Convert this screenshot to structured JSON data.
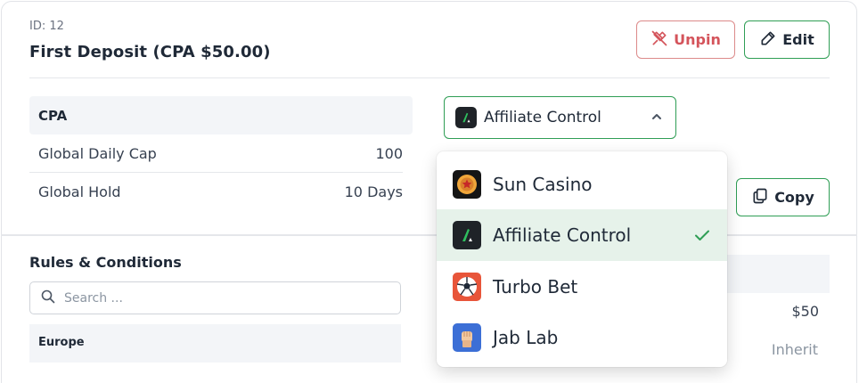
{
  "header": {
    "id_label": "ID: 12",
    "title": "First Deposit (CPA $50.00)",
    "unpin_label": "Unpin",
    "edit_label": "Edit"
  },
  "cpa": {
    "heading": "CPA",
    "rows": [
      {
        "label": "Global Daily Cap",
        "value": "100"
      },
      {
        "label": "Global Hold",
        "value": "10 Days"
      }
    ]
  },
  "brand_select": {
    "selected": "Affiliate Control",
    "options": [
      {
        "label": "Sun Casino",
        "icon": "sun-casino-logo"
      },
      {
        "label": "Affiliate Control",
        "icon": "affiliate-control-logo",
        "selected": true
      },
      {
        "label": "Turbo Bet",
        "icon": "turbo-bet-logo"
      },
      {
        "label": "Jab Lab",
        "icon": "jab-lab-logo"
      }
    ]
  },
  "copy_label": "Copy",
  "rules": {
    "title": "Rules & Conditions",
    "search_placeholder": "Search ...",
    "region": "Europe",
    "amount": "$50",
    "inherit": "Inherit"
  },
  "colors": {
    "accent_green": "#2f9e55",
    "danger_red": "#d4545b",
    "selected_bg": "#e6f2ea"
  }
}
